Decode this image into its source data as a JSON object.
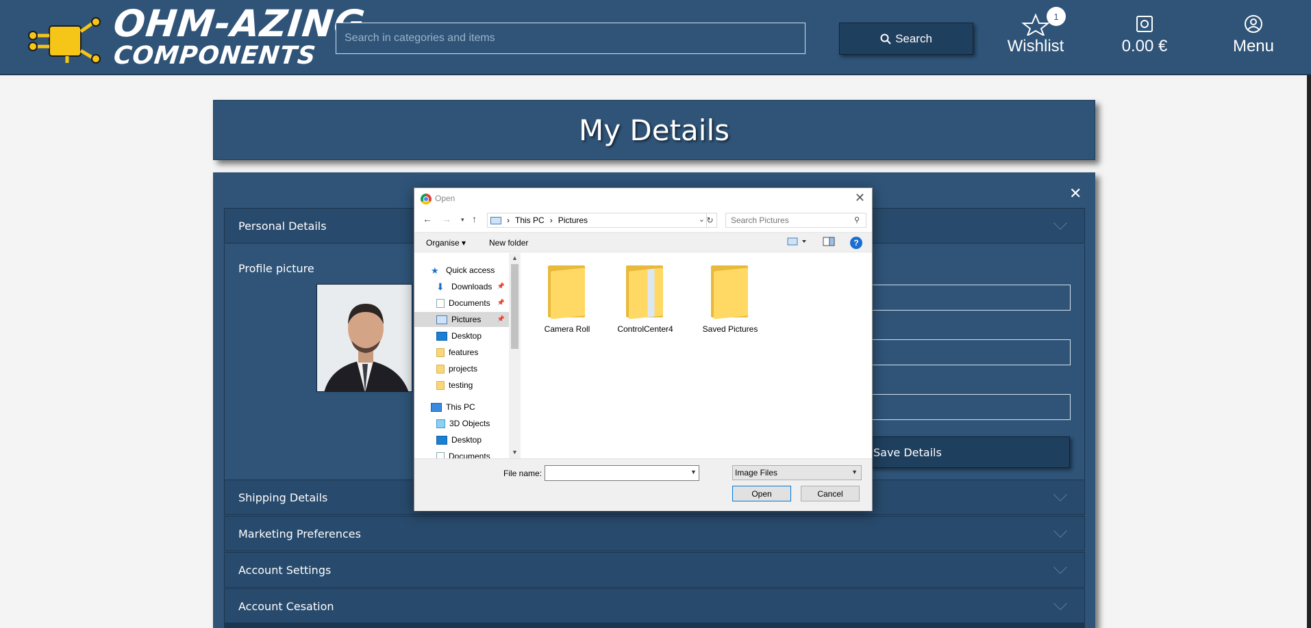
{
  "header": {
    "logo_line1": "OHM-AZING",
    "logo_line2": "COMPONENTS",
    "search_placeholder": "Search in categories and items",
    "search_button": "Search",
    "wishlist_label": "Wishlist",
    "wishlist_count": "1",
    "cart_total": "0.00 €",
    "menu_label": "Menu"
  },
  "page": {
    "title": "My Details",
    "sections": {
      "personal": "Personal Details",
      "shipping": "Shipping Details",
      "marketing": "Marketing Preferences",
      "account": "Account Settings",
      "cessation": "Account Cesation"
    },
    "profile_picture_label": "Profile picture",
    "save_button": "Save Details"
  },
  "dialog": {
    "title": "Open",
    "path": [
      "This PC",
      "Pictures"
    ],
    "search_placeholder": "Search Pictures",
    "organise": "Organise",
    "new_folder": "New folder",
    "help": "?",
    "nav": {
      "quick_access": "Quick access",
      "downloads": "Downloads",
      "documents": "Documents",
      "pictures": "Pictures",
      "desktop": "Desktop",
      "features": "features",
      "projects": "projects",
      "testing": "testing",
      "this_pc": "This PC",
      "objects3d": "3D Objects",
      "desktop2": "Desktop",
      "documents2": "Documents"
    },
    "folders": [
      "Camera Roll",
      "ControlCenter4",
      "Saved Pictures"
    ],
    "file_name_label": "File name:",
    "file_type": "Image Files",
    "open_button": "Open",
    "cancel_button": "Cancel"
  },
  "colors": {
    "primary": "#2f5478",
    "dark": "#1f3f5e",
    "folder": "#ffd964"
  }
}
